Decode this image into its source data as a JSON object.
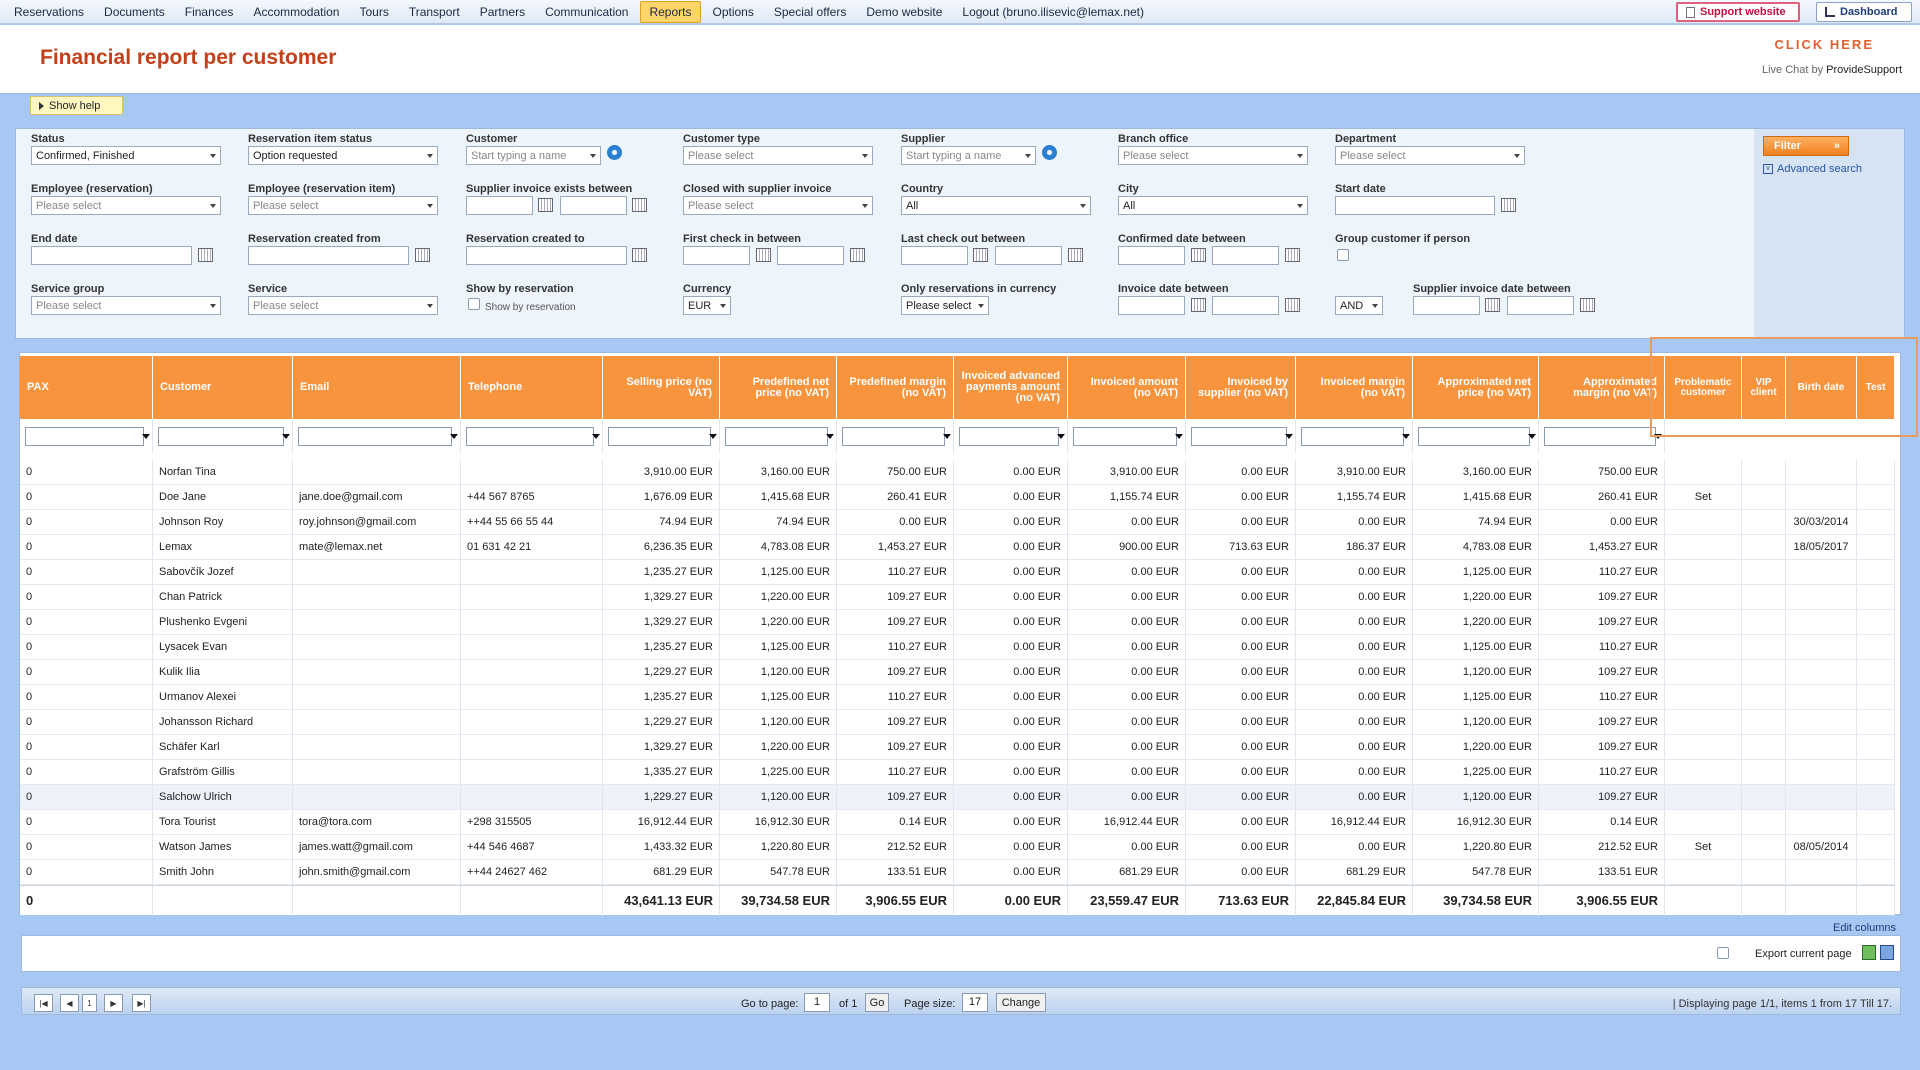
{
  "nav": {
    "items": [
      "Reservations",
      "Documents",
      "Finances",
      "Accommodation",
      "Tours",
      "Transport",
      "Partners",
      "Communication",
      "Reports",
      "Options",
      "Special offers",
      "Demo website",
      "Logout (bruno.ilisevic@lemax.net)"
    ],
    "active": "Reports",
    "support_label": "Support website",
    "dashboard_label": "Dashboard"
  },
  "header": {
    "title": "Financial report per customer",
    "click_here": "CLICK HERE",
    "live_chat_prefix": "Live Chat by ",
    "live_chat_brand": "ProvideSupport"
  },
  "help": {
    "label": "Show help"
  },
  "filters": {
    "status": {
      "label": "Status",
      "value": "Confirmed, Finished"
    },
    "reservation_item_status": {
      "label": "Reservation item status",
      "value": "Option requested"
    },
    "customer": {
      "label": "Customer",
      "placeholder": "Start typing a name"
    },
    "customer_type": {
      "label": "Customer type",
      "placeholder": "Please select"
    },
    "supplier": {
      "label": "Supplier",
      "placeholder": "Start typing a name"
    },
    "branch_office": {
      "label": "Branch office",
      "placeholder": "Please select"
    },
    "department": {
      "label": "Department",
      "placeholder": "Please select"
    },
    "employee_reservation": {
      "label": "Employee (reservation)",
      "placeholder": "Please select"
    },
    "employee_reservation_item": {
      "label": "Employee (reservation item)",
      "placeholder": "Please select"
    },
    "supplier_invoice_exists": {
      "label": "Supplier invoice exists between"
    },
    "closed_with_supplier_invoice": {
      "label": "Closed with supplier invoice",
      "placeholder": "Please select"
    },
    "country": {
      "label": "Country",
      "value": "All"
    },
    "city": {
      "label": "City",
      "value": "All"
    },
    "start_date": {
      "label": "Start date"
    },
    "end_date": {
      "label": "End date"
    },
    "reservation_created_from": {
      "label": "Reservation created from"
    },
    "reservation_created_to": {
      "label": "Reservation created to"
    },
    "first_check_in": {
      "label": "First check in between"
    },
    "last_check_out": {
      "label": "Last check out between"
    },
    "confirmed_date": {
      "label": "Confirmed date between"
    },
    "group_customer": {
      "label": "Group customer if person"
    },
    "service_group": {
      "label": "Service group",
      "placeholder": "Please select"
    },
    "service": {
      "label": "Service",
      "placeholder": "Please select"
    },
    "show_by_reservation": {
      "label": "Show by reservation",
      "option": "Show by reservation"
    },
    "currency": {
      "label": "Currency",
      "value": "EUR"
    },
    "only_reservations_currency": {
      "label": "Only reservations in currency",
      "value": "Please select"
    },
    "invoice_date": {
      "label": "Invoice date between"
    },
    "logic": {
      "value": "AND"
    },
    "supplier_invoice_date": {
      "label": "Supplier invoice date between"
    },
    "filter_button": "Filter",
    "advanced_search": "Advanced search"
  },
  "table": {
    "columns": [
      "PAX",
      "Customer",
      "Email",
      "Telephone",
      "Selling price (no VAT)",
      "Predefined net price (no VAT)",
      "Predefined margin (no VAT)",
      "Invoiced advanced payments amount (no VAT)",
      "Invoiced amount (no VAT)",
      "Invoiced by supplier (no VAT)",
      "Invoiced margin (no VAT)",
      "Approximated net price (no VAT)",
      "Approximated margin (no VAT)",
      "Problematic customer",
      "VIP client",
      "Birth date",
      "Test"
    ],
    "rows": [
      [
        "0",
        "Norfan Tina",
        "",
        "",
        "3,910.00 EUR",
        "3,160.00 EUR",
        "750.00 EUR",
        "0.00 EUR",
        "3,910.00 EUR",
        "0.00 EUR",
        "3,910.00 EUR",
        "3,160.00 EUR",
        "750.00 EUR",
        "",
        "",
        "",
        ""
      ],
      [
        "0",
        "Doe Jane",
        "jane.doe@gmail.com",
        "+44 567 8765",
        "1,676.09 EUR",
        "1,415.68 EUR",
        "260.41 EUR",
        "0.00 EUR",
        "1,155.74 EUR",
        "0.00 EUR",
        "1,155.74 EUR",
        "1,415.68 EUR",
        "260.41 EUR",
        "Set",
        "",
        "",
        ""
      ],
      [
        "0",
        "Johnson Roy",
        "roy.johnson@gmail.com",
        "++44 55 66 55 44",
        "74.94 EUR",
        "74.94 EUR",
        "0.00 EUR",
        "0.00 EUR",
        "0.00 EUR",
        "0.00 EUR",
        "0.00 EUR",
        "74.94 EUR",
        "0.00 EUR",
        "",
        "",
        "30/03/2014",
        ""
      ],
      [
        "0",
        "Lemax",
        "mate@lemax.net",
        "01 631 42 21",
        "6,236.35 EUR",
        "4,783.08 EUR",
        "1,453.27 EUR",
        "0.00 EUR",
        "900.00 EUR",
        "713.63 EUR",
        "186.37 EUR",
        "4,783.08 EUR",
        "1,453.27 EUR",
        "",
        "",
        "18/05/2017",
        ""
      ],
      [
        "0",
        "Sabovčík Jozef",
        "",
        "",
        "1,235.27 EUR",
        "1,125.00 EUR",
        "110.27 EUR",
        "0.00 EUR",
        "0.00 EUR",
        "0.00 EUR",
        "0.00 EUR",
        "1,125.00 EUR",
        "110.27 EUR",
        "",
        "",
        "",
        ""
      ],
      [
        "0",
        "Chan Patrick",
        "",
        "",
        "1,329.27 EUR",
        "1,220.00 EUR",
        "109.27 EUR",
        "0.00 EUR",
        "0.00 EUR",
        "0.00 EUR",
        "0.00 EUR",
        "1,220.00 EUR",
        "109.27 EUR",
        "",
        "",
        "",
        ""
      ],
      [
        "0",
        "Plushenko Evgeni",
        "",
        "",
        "1,329.27 EUR",
        "1,220.00 EUR",
        "109.27 EUR",
        "0.00 EUR",
        "0.00 EUR",
        "0.00 EUR",
        "0.00 EUR",
        "1,220.00 EUR",
        "109.27 EUR",
        "",
        "",
        "",
        ""
      ],
      [
        "0",
        "Lysacek Evan",
        "",
        "",
        "1,235.27 EUR",
        "1,125.00 EUR",
        "110.27 EUR",
        "0.00 EUR",
        "0.00 EUR",
        "0.00 EUR",
        "0.00 EUR",
        "1,125.00 EUR",
        "110.27 EUR",
        "",
        "",
        "",
        ""
      ],
      [
        "0",
        "Kulik Ilia",
        "",
        "",
        "1,229.27 EUR",
        "1,120.00 EUR",
        "109.27 EUR",
        "0.00 EUR",
        "0.00 EUR",
        "0.00 EUR",
        "0.00 EUR",
        "1,120.00 EUR",
        "109.27 EUR",
        "",
        "",
        "",
        ""
      ],
      [
        "0",
        "Urmanov Alexei",
        "",
        "",
        "1,235.27 EUR",
        "1,125.00 EUR",
        "110.27 EUR",
        "0.00 EUR",
        "0.00 EUR",
        "0.00 EUR",
        "0.00 EUR",
        "1,125.00 EUR",
        "110.27 EUR",
        "",
        "",
        "",
        ""
      ],
      [
        "0",
        "Johansson Richard",
        "",
        "",
        "1,229.27 EUR",
        "1,120.00 EUR",
        "109.27 EUR",
        "0.00 EUR",
        "0.00 EUR",
        "0.00 EUR",
        "0.00 EUR",
        "1,120.00 EUR",
        "109.27 EUR",
        "",
        "",
        "",
        ""
      ],
      [
        "0",
        "Schäfer Karl",
        "",
        "",
        "1,329.27 EUR",
        "1,220.00 EUR",
        "109.27 EUR",
        "0.00 EUR",
        "0.00 EUR",
        "0.00 EUR",
        "0.00 EUR",
        "1,220.00 EUR",
        "109.27 EUR",
        "",
        "",
        "",
        ""
      ],
      [
        "0",
        "Grafström Gillis",
        "",
        "",
        "1,335.27 EUR",
        "1,225.00 EUR",
        "110.27 EUR",
        "0.00 EUR",
        "0.00 EUR",
        "0.00 EUR",
        "0.00 EUR",
        "1,225.00 EUR",
        "110.27 EUR",
        "",
        "",
        "",
        ""
      ],
      [
        "0",
        "Salchow Ulrich",
        "",
        "",
        "1,229.27 EUR",
        "1,120.00 EUR",
        "109.27 EUR",
        "0.00 EUR",
        "0.00 EUR",
        "0.00 EUR",
        "0.00 EUR",
        "1,120.00 EUR",
        "109.27 EUR",
        "",
        "",
        "",
        ""
      ],
      [
        "0",
        "Tora Tourist",
        "tora@tora.com",
        "+298 315505",
        "16,912.44 EUR",
        "16,912.30 EUR",
        "0.14 EUR",
        "0.00 EUR",
        "16,912.44 EUR",
        "0.00 EUR",
        "16,912.44 EUR",
        "16,912.30 EUR",
        "0.14 EUR",
        "",
        "",
        "",
        ""
      ],
      [
        "0",
        "Watson James",
        "james.watt@gmail.com",
        "+44 546 4687",
        "1,433.32 EUR",
        "1,220.80 EUR",
        "212.52 EUR",
        "0.00 EUR",
        "0.00 EUR",
        "0.00 EUR",
        "0.00 EUR",
        "1,220.80 EUR",
        "212.52 EUR",
        "Set",
        "",
        "08/05/2014",
        ""
      ],
      [
        "0",
        "Smith John",
        "john.smith@gmail.com",
        "++44 24627 462",
        "681.29 EUR",
        "547.78 EUR",
        "133.51 EUR",
        "0.00 EUR",
        "681.29 EUR",
        "0.00 EUR",
        "681.29 EUR",
        "547.78 EUR",
        "133.51 EUR",
        "",
        "",
        "",
        ""
      ]
    ],
    "totals": [
      "0",
      "",
      "",
      "",
      "43,641.13 EUR",
      "39,734.58 EUR",
      "3,906.55 EUR",
      "0.00 EUR",
      "23,559.47 EUR",
      "713.63 EUR",
      "22,845.84 EUR",
      "39,734.58 EUR",
      "3,906.55 EUR",
      "",
      "",
      "",
      ""
    ],
    "highlighted_row_index": 13
  },
  "footer": {
    "edit_columns": "Edit columns",
    "export_label": "Export current page",
    "pager": {
      "current_page": "1",
      "go_to_label": "Go to page:",
      "go_to_value": "1",
      "of_label": "of 1",
      "go_button": "Go",
      "page_size_label": "Page size:",
      "page_size_value": "17",
      "change_button": "Change",
      "status": "| Displaying page  1/1,  items  1  from  17  Till  17."
    }
  }
}
